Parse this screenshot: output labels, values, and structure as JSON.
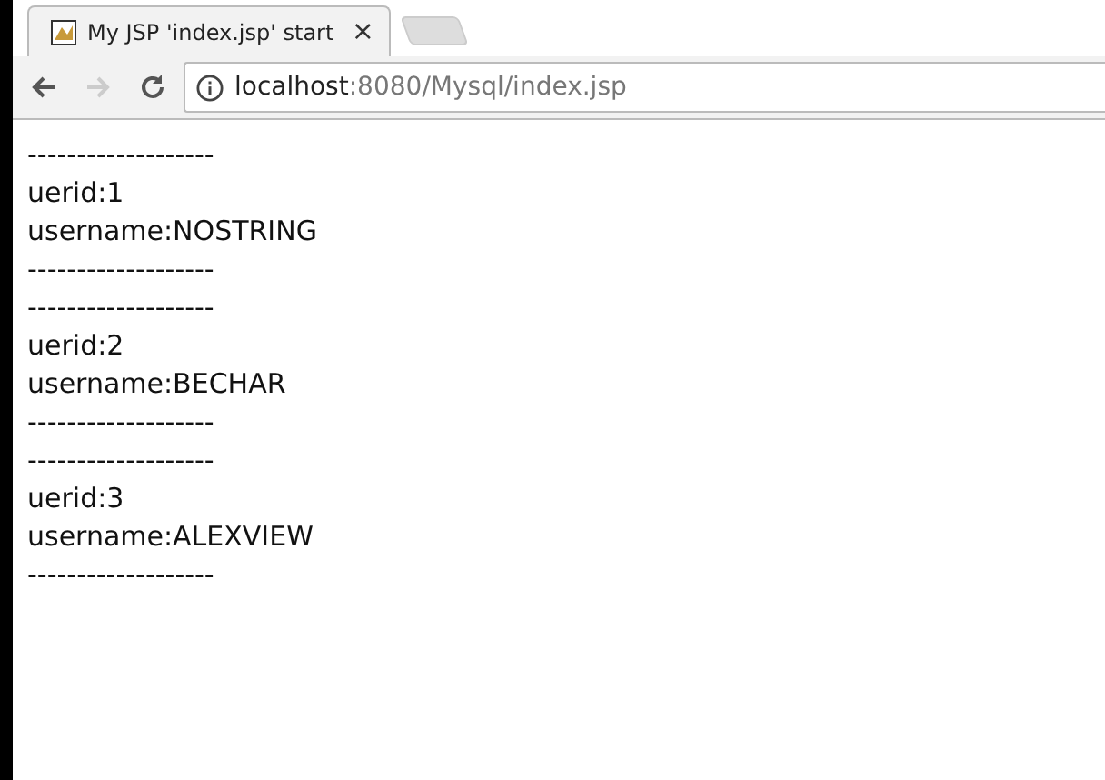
{
  "tab": {
    "title": "My JSP 'index.jsp' start",
    "close": "×"
  },
  "address_bar": {
    "host": "localhost",
    "path": ":8080/Mysql/index.jsp"
  },
  "nav": {
    "back_disabled": false,
    "forward_disabled": true
  },
  "lines": [
    "-------------------",
    "uerid:1",
    "username:NOSTRING",
    "-------------------",
    "-------------------",
    "uerid:2",
    "username:BECHAR",
    "-------------------",
    "-------------------",
    "uerid:3",
    "username:ALEXVIEW",
    "-------------------"
  ]
}
